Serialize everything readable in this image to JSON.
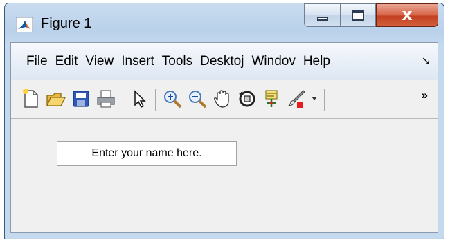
{
  "window": {
    "title": "Figure 1",
    "caption_buttons": [
      "minimize-icon",
      "maximize-icon",
      "close-icon"
    ]
  },
  "menubar": {
    "items": [
      "File",
      "Edit",
      "View",
      "Insert",
      "Tools",
      "Desktoj",
      "Windov",
      "Help"
    ],
    "overflow_glyph": "↘"
  },
  "toolbar": {
    "icons": [
      "new-figure-icon",
      "open-file-icon",
      "save-icon",
      "print-icon",
      "pointer-icon",
      "zoom-in-icon",
      "zoom-out-icon",
      "pan-hand-icon",
      "rotate-3d-icon",
      "data-cursor-icon",
      "brush-icon"
    ],
    "overflow_glyph": "»"
  },
  "canvas": {
    "edit_text": "Enter your name here."
  },
  "colors": {
    "close_button": "#c9482a",
    "title_bar": "#b9d1ea",
    "figure_background": "#f0f0f0"
  }
}
